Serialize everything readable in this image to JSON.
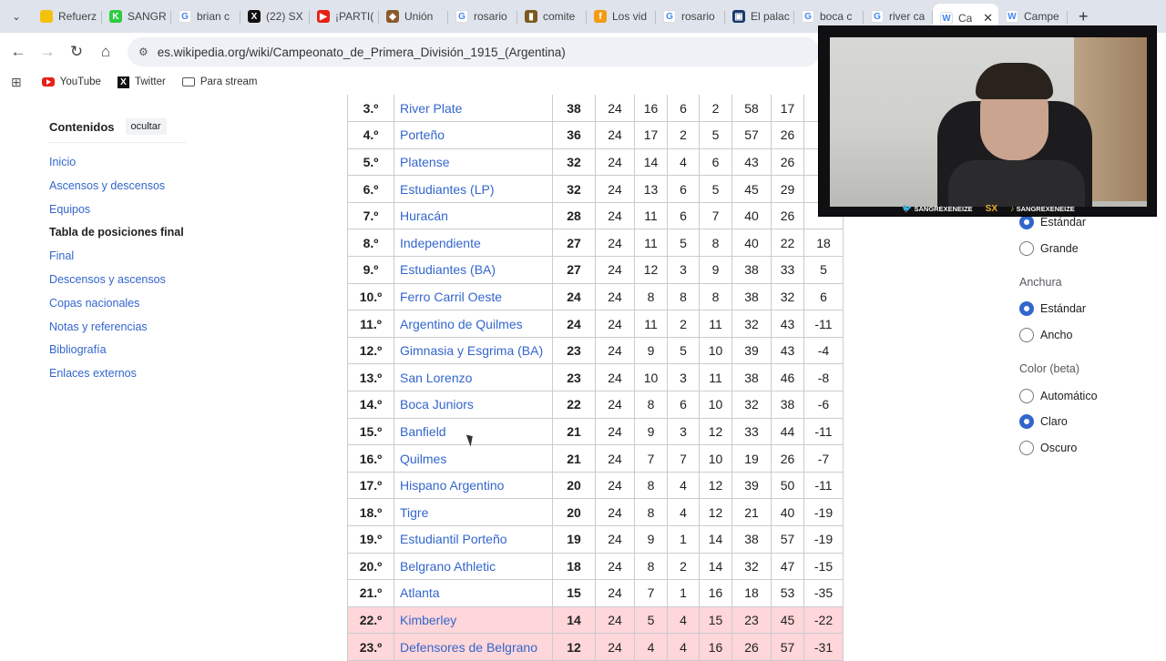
{
  "browser": {
    "tabs": [
      {
        "title": "Refuerz",
        "color": "#f4c20d",
        "glyph": ""
      },
      {
        "title": "SANGR",
        "color": "#2ecc40",
        "glyph": "K"
      },
      {
        "title": "brian c",
        "color": "#ffffff",
        "glyph": "G"
      },
      {
        "title": "(22) SX",
        "color": "#111111",
        "glyph": "X"
      },
      {
        "title": "¡PARTI(",
        "color": "#e62117",
        "glyph": "▶"
      },
      {
        "title": "Unión",
        "color": "#8a5a2b",
        "glyph": "◆"
      },
      {
        "title": "rosario",
        "color": "#ffffff",
        "glyph": "G"
      },
      {
        "title": "comite",
        "color": "#7a5a1e",
        "glyph": "▮"
      },
      {
        "title": "Los vid",
        "color": "#f39c12",
        "glyph": "f"
      },
      {
        "title": "rosario",
        "color": "#ffffff",
        "glyph": "G"
      },
      {
        "title": "El palac",
        "color": "#1a3a6b",
        "glyph": "▣"
      },
      {
        "title": "boca c",
        "color": "#ffffff",
        "glyph": "G"
      },
      {
        "title": "river ca",
        "color": "#ffffff",
        "glyph": "G"
      },
      {
        "title": "Ca",
        "color": "#ffffff",
        "glyph": "W",
        "active": true
      },
      {
        "title": "Campe",
        "color": "#ffffff",
        "glyph": "W"
      }
    ],
    "url": "es.wikipedia.org/wiki/Campeonato_de_Primera_División_1915_(Argentina)",
    "bookmarks": {
      "youtube": "YouTube",
      "twitter": "Twitter",
      "stream": "Para stream"
    }
  },
  "toc": {
    "title": "Contenidos",
    "hide_label": "ocultar",
    "items": [
      "Inicio",
      "Ascensos y descensos",
      "Equipos",
      "Tabla de posiciones final",
      "Final",
      "Descensos y ascensos",
      "Copas nacionales",
      "Notas y referencias",
      "Bibliografía",
      "Enlaces externos"
    ],
    "current": "Tabla de posiciones final"
  },
  "standings": [
    {
      "pos": "3.º",
      "team": "River Plate",
      "pts": "38",
      "pj": "24",
      "g": "16",
      "e": "6",
      "p": "2",
      "gf": "58",
      "gc": "17",
      "dif": "",
      "rel": false
    },
    {
      "pos": "4.º",
      "team": "Porteño",
      "pts": "36",
      "pj": "24",
      "g": "17",
      "e": "2",
      "p": "5",
      "gf": "57",
      "gc": "26",
      "dif": "",
      "rel": false
    },
    {
      "pos": "5.º",
      "team": "Platense",
      "pts": "32",
      "pj": "24",
      "g": "14",
      "e": "4",
      "p": "6",
      "gf": "43",
      "gc": "26",
      "dif": "",
      "rel": false
    },
    {
      "pos": "6.º",
      "team": "Estudiantes (LP)",
      "pts": "32",
      "pj": "24",
      "g": "13",
      "e": "6",
      "p": "5",
      "gf": "45",
      "gc": "29",
      "dif": "",
      "rel": false
    },
    {
      "pos": "7.º",
      "team": "Huracán",
      "pts": "28",
      "pj": "24",
      "g": "11",
      "e": "6",
      "p": "7",
      "gf": "40",
      "gc": "26",
      "dif": "",
      "rel": false
    },
    {
      "pos": "8.º",
      "team": "Independiente",
      "pts": "27",
      "pj": "24",
      "g": "11",
      "e": "5",
      "p": "8",
      "gf": "40",
      "gc": "22",
      "dif": "18",
      "rel": false
    },
    {
      "pos": "9.º",
      "team": "Estudiantes (BA)",
      "pts": "27",
      "pj": "24",
      "g": "12",
      "e": "3",
      "p": "9",
      "gf": "38",
      "gc": "33",
      "dif": "5",
      "rel": false
    },
    {
      "pos": "10.º",
      "team": "Ferro Carril Oeste",
      "pts": "24",
      "pj": "24",
      "g": "8",
      "e": "8",
      "p": "8",
      "gf": "38",
      "gc": "32",
      "dif": "6",
      "rel": false
    },
    {
      "pos": "11.º",
      "team": "Argentino de Quilmes",
      "pts": "24",
      "pj": "24",
      "g": "11",
      "e": "2",
      "p": "11",
      "gf": "32",
      "gc": "43",
      "dif": "-11",
      "rel": false
    },
    {
      "pos": "12.º",
      "team": "Gimnasia y Esgrima (BA)",
      "pts": "23",
      "pj": "24",
      "g": "9",
      "e": "5",
      "p": "10",
      "gf": "39",
      "gc": "43",
      "dif": "-4",
      "rel": false
    },
    {
      "pos": "13.º",
      "team": "San Lorenzo",
      "pts": "23",
      "pj": "24",
      "g": "10",
      "e": "3",
      "p": "11",
      "gf": "38",
      "gc": "46",
      "dif": "-8",
      "rel": false
    },
    {
      "pos": "14.º",
      "team": "Boca Juniors",
      "pts": "22",
      "pj": "24",
      "g": "8",
      "e": "6",
      "p": "10",
      "gf": "32",
      "gc": "38",
      "dif": "-6",
      "rel": false
    },
    {
      "pos": "15.º",
      "team": "Banfield",
      "pts": "21",
      "pj": "24",
      "g": "9",
      "e": "3",
      "p": "12",
      "gf": "33",
      "gc": "44",
      "dif": "-11",
      "rel": false
    },
    {
      "pos": "16.º",
      "team": "Quilmes",
      "pts": "21",
      "pj": "24",
      "g": "7",
      "e": "7",
      "p": "10",
      "gf": "19",
      "gc": "26",
      "dif": "-7",
      "rel": false
    },
    {
      "pos": "17.º",
      "team": "Hispano Argentino",
      "pts": "20",
      "pj": "24",
      "g": "8",
      "e": "4",
      "p": "12",
      "gf": "39",
      "gc": "50",
      "dif": "-11",
      "rel": false
    },
    {
      "pos": "18.º",
      "team": "Tigre",
      "pts": "20",
      "pj": "24",
      "g": "8",
      "e": "4",
      "p": "12",
      "gf": "21",
      "gc": "40",
      "dif": "-19",
      "rel": false
    },
    {
      "pos": "19.º",
      "team": "Estudiantil Porteño",
      "pts": "19",
      "pj": "24",
      "g": "9",
      "e": "1",
      "p": "14",
      "gf": "38",
      "gc": "57",
      "dif": "-19",
      "rel": false
    },
    {
      "pos": "20.º",
      "team": "Belgrano Athletic",
      "pts": "18",
      "pj": "24",
      "g": "8",
      "e": "2",
      "p": "14",
      "gf": "32",
      "gc": "47",
      "dif": "-15",
      "rel": false
    },
    {
      "pos": "21.º",
      "team": "Atlanta",
      "pts": "15",
      "pj": "24",
      "g": "7",
      "e": "1",
      "p": "16",
      "gf": "18",
      "gc": "53",
      "dif": "-35",
      "rel": false
    },
    {
      "pos": "22.º",
      "team": "Kimberley",
      "pts": "14",
      "pj": "24",
      "g": "5",
      "e": "4",
      "p": "15",
      "gf": "23",
      "gc": "45",
      "dif": "-22",
      "rel": true
    },
    {
      "pos": "23.º",
      "team": "Defensores de Belgrano",
      "pts": "12",
      "pj": "24",
      "g": "4",
      "e": "4",
      "p": "16",
      "gf": "26",
      "gc": "57",
      "dif": "-31",
      "rel": true
    }
  ],
  "appearance": {
    "text_options": [
      {
        "label": "Estándar",
        "checked": true
      },
      {
        "label": "Grande",
        "checked": false
      }
    ],
    "width_title": "Anchura",
    "width_options": [
      {
        "label": "Estándar",
        "checked": true
      },
      {
        "label": "Ancho",
        "checked": false
      }
    ],
    "color_title": "Color (beta)",
    "color_options": [
      {
        "label": "Automático",
        "checked": false
      },
      {
        "label": "Claro",
        "checked": true
      },
      {
        "label": "Oscuro",
        "checked": false
      }
    ]
  },
  "webcam": {
    "handle_left": "SANGREXENEIZE",
    "logo": "SX",
    "handle_right": "SANGREXENEIZE"
  }
}
